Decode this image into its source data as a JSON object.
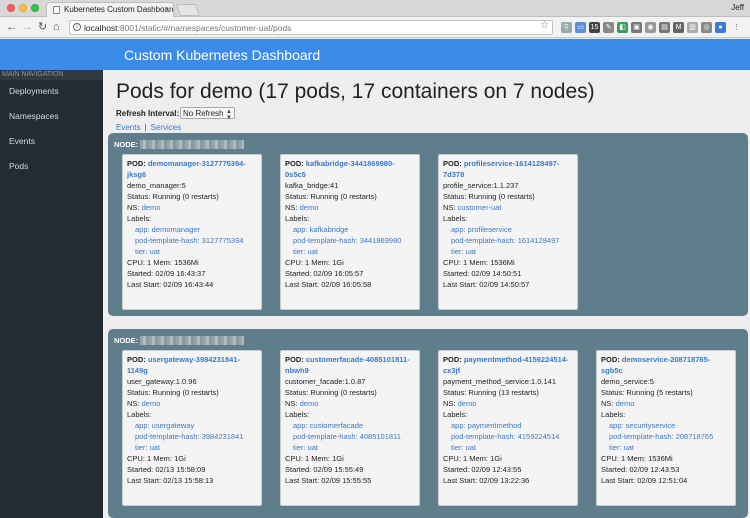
{
  "browser": {
    "tab_title": "Kubernetes Custom Dashboard",
    "user": "Jeff",
    "url_host": "localhost",
    "url_path": ":8001/static/#/namespaces/customer-uat/pods"
  },
  "header": {
    "title": "Custom Kubernetes Dashboard"
  },
  "sidebar": {
    "heading": "MAIN NAVIGATION",
    "items": [
      {
        "label": "Deployments"
      },
      {
        "label": "Namespaces"
      },
      {
        "label": "Events"
      },
      {
        "label": "Pods"
      }
    ]
  },
  "main": {
    "title": "Pods for demo (17 pods, 17 containers on 7 nodes)",
    "refresh_label": "Refresh Interval:",
    "refresh_value": "No Refresh",
    "links": [
      {
        "label": "Events"
      },
      {
        "label": "Services"
      }
    ],
    "node_label": "NODE:",
    "nodes": [
      {
        "pods": [
          {
            "pod_label": "POD:",
            "name_line1": "demomanager-3127775394-",
            "name_line2": "jksg6",
            "image": "demo_manager:5",
            "status": "Status: Running  (0 restarts)",
            "ns_label": "NS:",
            "ns": "demo",
            "labels_title": "Labels:",
            "label_app": "app: demomanager",
            "label_hash": "pod-template-hash: 3127775394",
            "label_tier": "tier: uat",
            "resources": "CPU: 1 Mem: 1536Mi",
            "started": "Started: 02/09 16:43:37",
            "last_start": "Last Start: 02/09 16:43:44"
          },
          {
            "pod_label": "POD:",
            "name_line1": "kafkabridge-3441869980-",
            "name_line2": "0s5c5",
            "image": "kafka_bridge:41",
            "status": "Status: Running  (0 restarts)",
            "ns_label": "NS:",
            "ns": "demo",
            "labels_title": "Labels:",
            "label_app": "app: kafkabridge",
            "label_hash": "pod-template-hash: 3441869980",
            "label_tier": "tier: uat",
            "resources": "CPU: 1 Mem: 1Gi",
            "started": "Started: 02/09 16:05:57",
            "last_start": "Last Start: 02/09 16:05:58"
          },
          {
            "pod_label": "POD:",
            "name_line1": "profileservice-1614128497-",
            "name_line2": "7d378",
            "image": "profile_service:1.1.237",
            "status": "Status: Running  (0 restarts)",
            "ns_label": "NS:",
            "ns": "customer-uat",
            "labels_title": "Labels:",
            "label_app": "app: profileservice",
            "label_hash": "pod-template-hash: 1614128497",
            "label_tier": "tier: uat",
            "resources": "CPU: 1 Mem: 1536Mi",
            "started": "Started: 02/09 14:50:51",
            "last_start": "Last Start: 02/09 14:50:57"
          }
        ]
      },
      {
        "pods": [
          {
            "pod_label": "POD:",
            "name_line1": "usergateway-3984231841-",
            "name_line2": "1149g",
            "image": "user_gateway:1.0.96",
            "status": "Status: Running  (0 restarts)",
            "ns_label": "NS:",
            "ns": "demo",
            "labels_title": "Labels:",
            "label_app": "app: usergateway",
            "label_hash": "pod-template-hash: 3984231841",
            "label_tier": "tier: uat",
            "resources": "CPU: 1 Mem: 1Gi",
            "started": "Started: 02/13 15:58:09",
            "last_start": "Last Start: 02/13 15:58:13"
          },
          {
            "pod_label": "POD:",
            "name_line1": "customerfacade-4085101811-",
            "name_line2": "nbwh9",
            "image": "customer_facade:1.0.87",
            "status": "Status: Running  (0 restarts)",
            "ns_label": "NS:",
            "ns": "demo",
            "labels_title": "Labels:",
            "label_app": "app: customerfacade",
            "label_hash": "pod-template-hash: 4085101811",
            "label_tier": "tier: uat",
            "resources": "CPU: 1 Mem: 1Gi",
            "started": "Started: 02/09 15:55:49",
            "last_start": "Last Start: 02/09 15:55:55"
          },
          {
            "pod_label": "POD:",
            "name_line1": "paymentmethod-4159224514-",
            "name_line2": "cx3jf",
            "image": "payment_method_service:1.0.141",
            "status": "Status: Running  (13 restarts)",
            "ns_label": "NS:",
            "ns": "demo",
            "labels_title": "Labels:",
            "label_app": "app: paymentmethod",
            "label_hash": "pod-template-hash: 4159224514",
            "label_tier": "tier: uat",
            "resources": "CPU: 1 Mem: 1Gi",
            "started": "Started: 02/09 12:43:55",
            "last_start": "Last Start: 02/09 13:22:36"
          },
          {
            "pod_label": "POD:",
            "name_line1": "demoservice-208718765-",
            "name_line2": "sgb5c",
            "image": "demo_service:5",
            "status": "Status: Running  (5 restarts)",
            "ns_label": "NS:",
            "ns": "demo",
            "labels_title": "Labels:",
            "label_app": "app: securityservice",
            "label_hash": "pod-template-hash: 208718765",
            "label_tier": "tier: uat",
            "resources": "CPU: 1 Mem: 1536Mi",
            "started": "Started: 02/09 12:43:53",
            "last_start": "Last Start: 02/09 12:51:04"
          }
        ]
      }
    ]
  }
}
